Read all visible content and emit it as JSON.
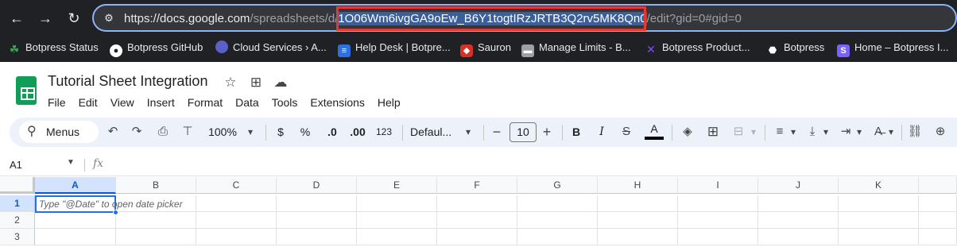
{
  "browser": {
    "url": {
      "host": "https://docs.google.com",
      "path_prefix": "/spreadsheets/d/",
      "selected": "1O06Wm6ivgGA9oEw_B6Y1togtIRzJRTB3Q2rv5MK8Qn0",
      "path_suffix": "/edit?gid=0#gid=0"
    },
    "highlight_color": "#e53935",
    "bookmarks": [
      {
        "label": "Botpress Status",
        "icon": "leaf-icon",
        "color": "#34a853"
      },
      {
        "label": "Botpress GitHub",
        "icon": "github-icon",
        "color": "#ffffff"
      },
      {
        "label": "Cloud Services › A...",
        "icon": "cloud-services-icon",
        "color": "#5b5fc7"
      },
      {
        "label": "Help Desk | Botpre...",
        "icon": "intercom-icon",
        "color": "#2f6fe0"
      },
      {
        "label": "Sauron",
        "icon": "sauron-icon",
        "color": "#d93025"
      },
      {
        "label": "Manage Limits - B...",
        "icon": "limits-icon",
        "color": "#9aa0a6"
      },
      {
        "label": "Botpress Product...",
        "icon": "product-icon",
        "color": "#7c4dff"
      },
      {
        "label": "Botpress",
        "icon": "botpress-icon",
        "color": "#ffffff"
      },
      {
        "label": "Home – Botpress I...",
        "icon": "home-s-icon",
        "color": "#7b61ff"
      }
    ]
  },
  "doc": {
    "title": "Tutorial Sheet Integration",
    "menus": [
      "File",
      "Edit",
      "View",
      "Insert",
      "Format",
      "Data",
      "Tools",
      "Extensions",
      "Help"
    ]
  },
  "toolbar": {
    "search_label": "Menus",
    "zoom": "100%",
    "currency": "$",
    "percent": "%",
    "decrease_decimal": ".0",
    "increase_decimal": ".00",
    "number_format": "123",
    "font": "Defaul...",
    "font_size": "10",
    "bold": "B",
    "italic": "I",
    "text_color_letter": "A"
  },
  "formula_bar": {
    "name_box": "A1",
    "fx": "fx"
  },
  "grid": {
    "columns": [
      "A",
      "B",
      "C",
      "D",
      "E",
      "F",
      "G",
      "H",
      "I",
      "J",
      "K"
    ],
    "rows": [
      "1",
      "2",
      "3"
    ],
    "active_cell": "A1",
    "hint": "Type \"@Date\" to open date picker"
  }
}
